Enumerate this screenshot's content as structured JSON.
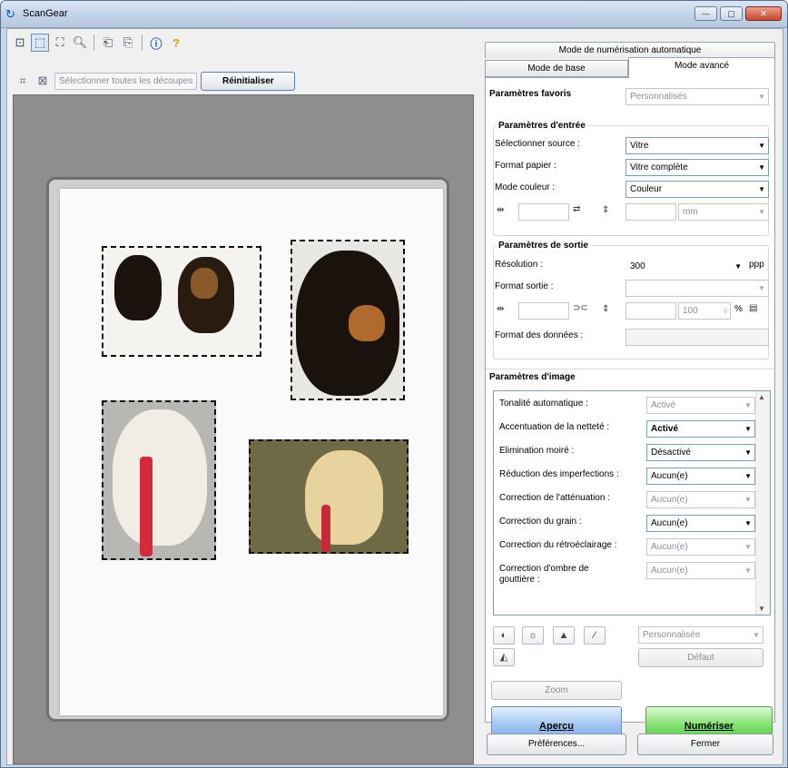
{
  "window": {
    "title": "ScanGear",
    "minimize": "—",
    "maximize": "▢",
    "close": "✕"
  },
  "toolbar": {
    "select_all_crops": "Sélectionner toutes les découpes",
    "reset": "Réinitialiser"
  },
  "tabs": {
    "auto": "Mode de numérisation automatique",
    "basic": "Mode de base",
    "advanced": "Mode avancé"
  },
  "favorites": {
    "label": "Paramètres favoris",
    "value": "Personnalisés"
  },
  "input": {
    "heading": "Paramètres d'entrée",
    "source_label": "Sélectionner source :",
    "source_value": "Vitre",
    "paper_label": "Format papier :",
    "paper_value": "Vitre complète",
    "color_label": "Mode couleur :",
    "color_value": "Couleur",
    "unit_value": "mm"
  },
  "output": {
    "heading": "Paramètres de sortie",
    "resolution_label": "Résolution :",
    "resolution_value": "300",
    "resolution_unit": "ppp",
    "format_label": "Format sortie :",
    "scale_value": "100",
    "percent": "%",
    "data_label": "Format des données :"
  },
  "image_settings": {
    "heading": "Paramètres d'image",
    "rows": [
      {
        "label": "Tonalité automatique :",
        "value": "Activé",
        "enabled": false
      },
      {
        "label": "Accentuation de la netteté :",
        "value": "Activé",
        "enabled": true
      },
      {
        "label": "Elimination moiré :",
        "value": "Désactivé",
        "enabled": true
      },
      {
        "label": "Réduction des imperfections :",
        "value": "Aucun(e)",
        "enabled": true
      },
      {
        "label": "Correction de l'atténuation :",
        "value": "Aucun(e)",
        "enabled": false
      },
      {
        "label": "Correction du grain :",
        "value": "Aucun(e)",
        "enabled": true
      },
      {
        "label": "Correction du rétroéclairage :",
        "value": "Aucun(e)",
        "enabled": false
      },
      {
        "label": "Correction d'ombre de gouttière :",
        "value": "Aucun(e)",
        "enabled": false
      }
    ]
  },
  "adjust": {
    "preset_value": "Personnalisée",
    "default": "Défaut"
  },
  "zoom": "Zoom",
  "preview_button": "Aperçu",
  "scan_button": "Numériser",
  "preferences": "Préférences...",
  "close": "Fermer"
}
